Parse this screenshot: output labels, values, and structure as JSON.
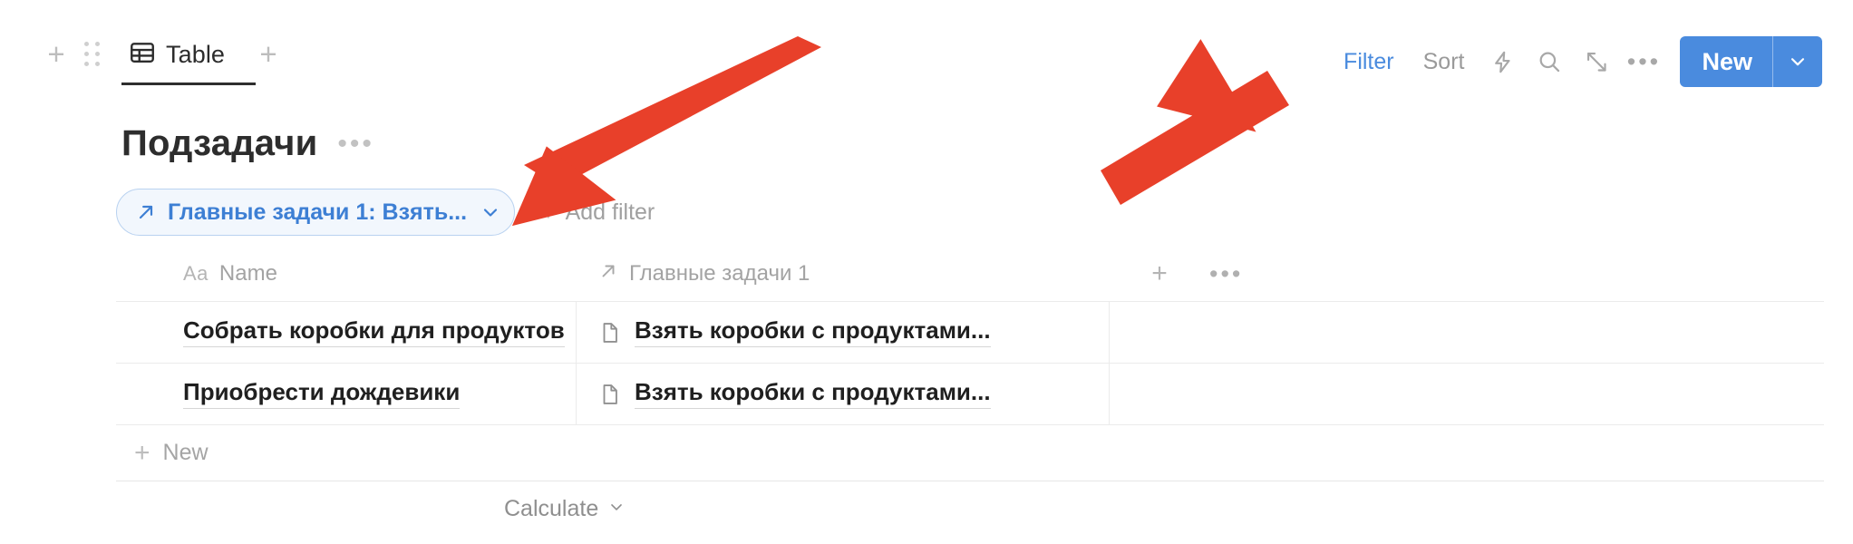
{
  "toolbar": {
    "add_view_left_icon": "plus-icon",
    "drag_handle_icon": "drag-handle-icon",
    "tab": {
      "label": "Table",
      "icon": "table-icon",
      "active": true
    },
    "add_tab_icon": "plus-icon",
    "filter_label": "Filter",
    "sort_label": "Sort",
    "automation_icon": "lightning-bolt-icon",
    "search_icon": "search-icon",
    "expand_icon": "expand-arrows-icon",
    "more_icon": "ellipsis-icon",
    "new_button": {
      "label": "New",
      "chevron_icon": "chevron-down-icon"
    },
    "accent_blue": "#4a8bde",
    "muted_gray": "#9a9a9a"
  },
  "header": {
    "title": "Подзадачи",
    "more_icon": "ellipsis-icon"
  },
  "filter_bar": {
    "pill": {
      "relation_icon": "arrow-up-right-icon",
      "label": "Главные задачи 1: Взять...",
      "chevron_icon": "chevron-down-icon",
      "text_color": "#3d7fd4",
      "background": "#f2f7fd",
      "border_color": "#b9d2f0"
    },
    "add_filter": {
      "plus_icon": "plus-icon",
      "label": "Add filter"
    }
  },
  "table": {
    "columns": [
      {
        "label": "Name",
        "type_icon": "aa-text-icon",
        "type_label": "Aa"
      },
      {
        "label": "Главные задачи 1",
        "type_icon": "arrow-up-right-icon"
      }
    ],
    "add_column_icon": "plus-icon",
    "column_options_icon": "ellipsis-icon",
    "rows": [
      {
        "name": "Собрать коробки для продуктов",
        "relation": {
          "page_icon": "page-icon",
          "label": "Взять коробки с продуктами..."
        }
      },
      {
        "name": "Приобрести дождевики",
        "relation": {
          "page_icon": "page-icon",
          "label": "Взять коробки с продуктами..."
        }
      }
    ],
    "new_row": {
      "plus_icon": "plus-icon",
      "label": "New"
    },
    "footer": {
      "calculate_label": "Calculate",
      "chevron_icon": "chevron-down-icon"
    }
  },
  "annotations": {
    "color": "#e8402a",
    "arrows": [
      {
        "name": "arrow-to-filter-pill-chevron",
        "points_to": "filter-pill-chevron"
      },
      {
        "name": "arrow-to-filter-button",
        "points_to": "filter-button"
      }
    ]
  }
}
